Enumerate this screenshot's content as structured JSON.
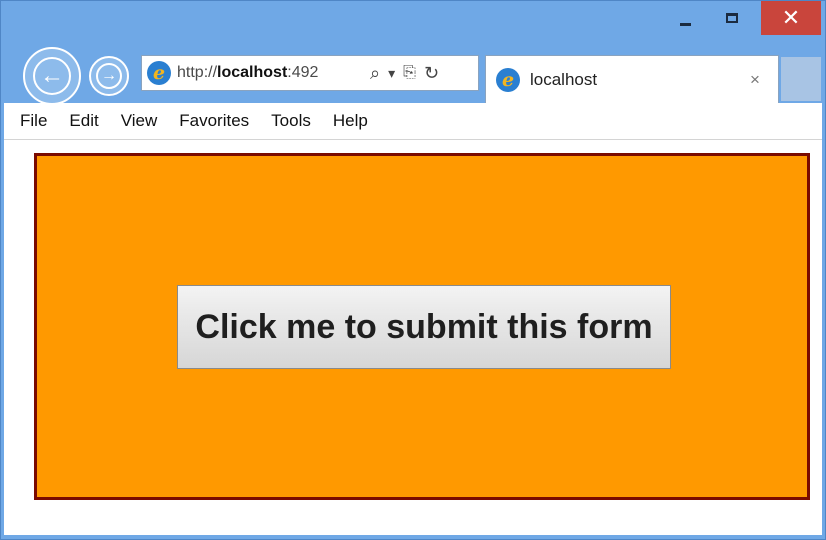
{
  "window": {
    "controls": {
      "minimize": "_",
      "maximize": "□",
      "close": "✕"
    }
  },
  "navigation": {
    "back_icon": "back-arrow-icon",
    "forward_icon": "forward-arrow-icon"
  },
  "address_bar": {
    "url_prefix": "http://",
    "url_host": "localhost",
    "url_rest": ":492",
    "search_icon": "⌕",
    "dropdown_icon": "▾",
    "compat_icon": "⎘",
    "refresh_icon": "↻"
  },
  "tab": {
    "title": "localhost",
    "close": "×"
  },
  "menu": {
    "items": [
      "File",
      "Edit",
      "View",
      "Favorites",
      "Tools",
      "Help"
    ]
  },
  "page": {
    "submit_label": "Click me to submit this form"
  },
  "colors": {
    "panel_bg": "#ff9900",
    "panel_border": "#7a0a00",
    "chrome": "#6fa8e6",
    "close_button": "#c9453c"
  }
}
